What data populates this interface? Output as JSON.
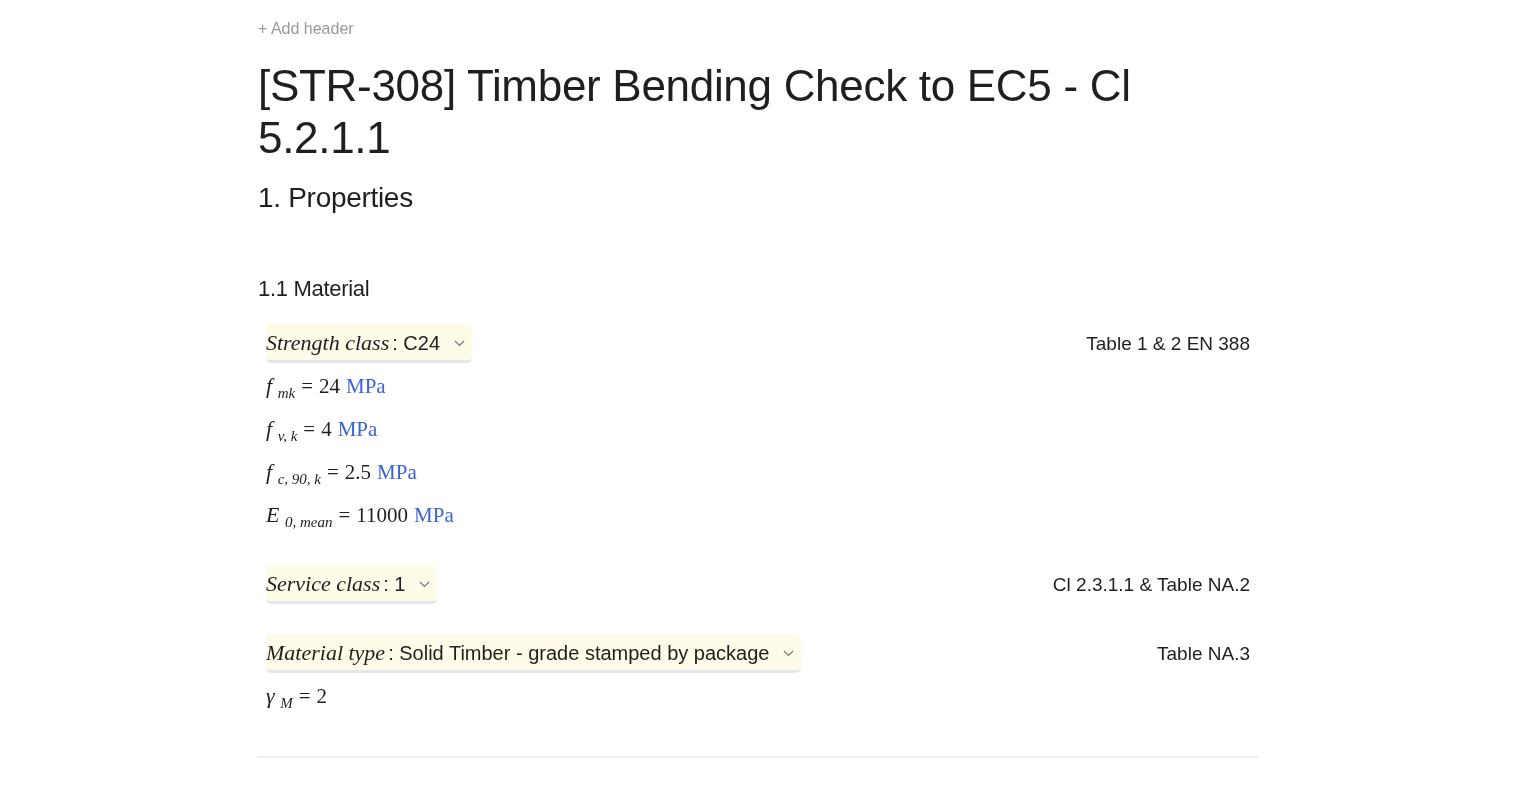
{
  "add_header": "+ Add header",
  "title": "[STR-308] Timber Bending Check to EC5 - Cl 5.2.1.1",
  "section": {
    "heading": "1. Properties",
    "subsection": {
      "heading": "1.1 Material",
      "blocks": [
        {
          "kind": "dropdown",
          "label": "Strength class",
          "value": ": C24",
          "reference": "Table 1 & 2 EN 388"
        },
        {
          "kind": "formula",
          "symbol": "f $_{mk}$",
          "relation": "=",
          "value": "24",
          "unit": "MPa"
        },
        {
          "kind": "formula",
          "symbol": "f $_{v, k}$",
          "relation": "=",
          "value": "4",
          "unit": "MPa"
        },
        {
          "kind": "formula",
          "symbol": "f $_{c, 90, k}$",
          "relation": "=",
          "value": "2.5",
          "unit": "MPa"
        },
        {
          "kind": "formula",
          "symbol": "E $_{0, mean}$",
          "relation": "=",
          "value": "11000",
          "unit": "MPa"
        },
        {
          "kind": "dropdown",
          "label": "Service class",
          "value": ": 1",
          "reference": "Cl 2.3.1.1 & Table NA.2"
        },
        {
          "kind": "dropdown",
          "label": "Material type",
          "value": ": Solid Timber - grade stamped by package",
          "reference": "Table NA.3"
        },
        {
          "kind": "formula",
          "symbol": "γ $_{M}$",
          "relation": "=",
          "value": "2"
        }
      ]
    }
  }
}
